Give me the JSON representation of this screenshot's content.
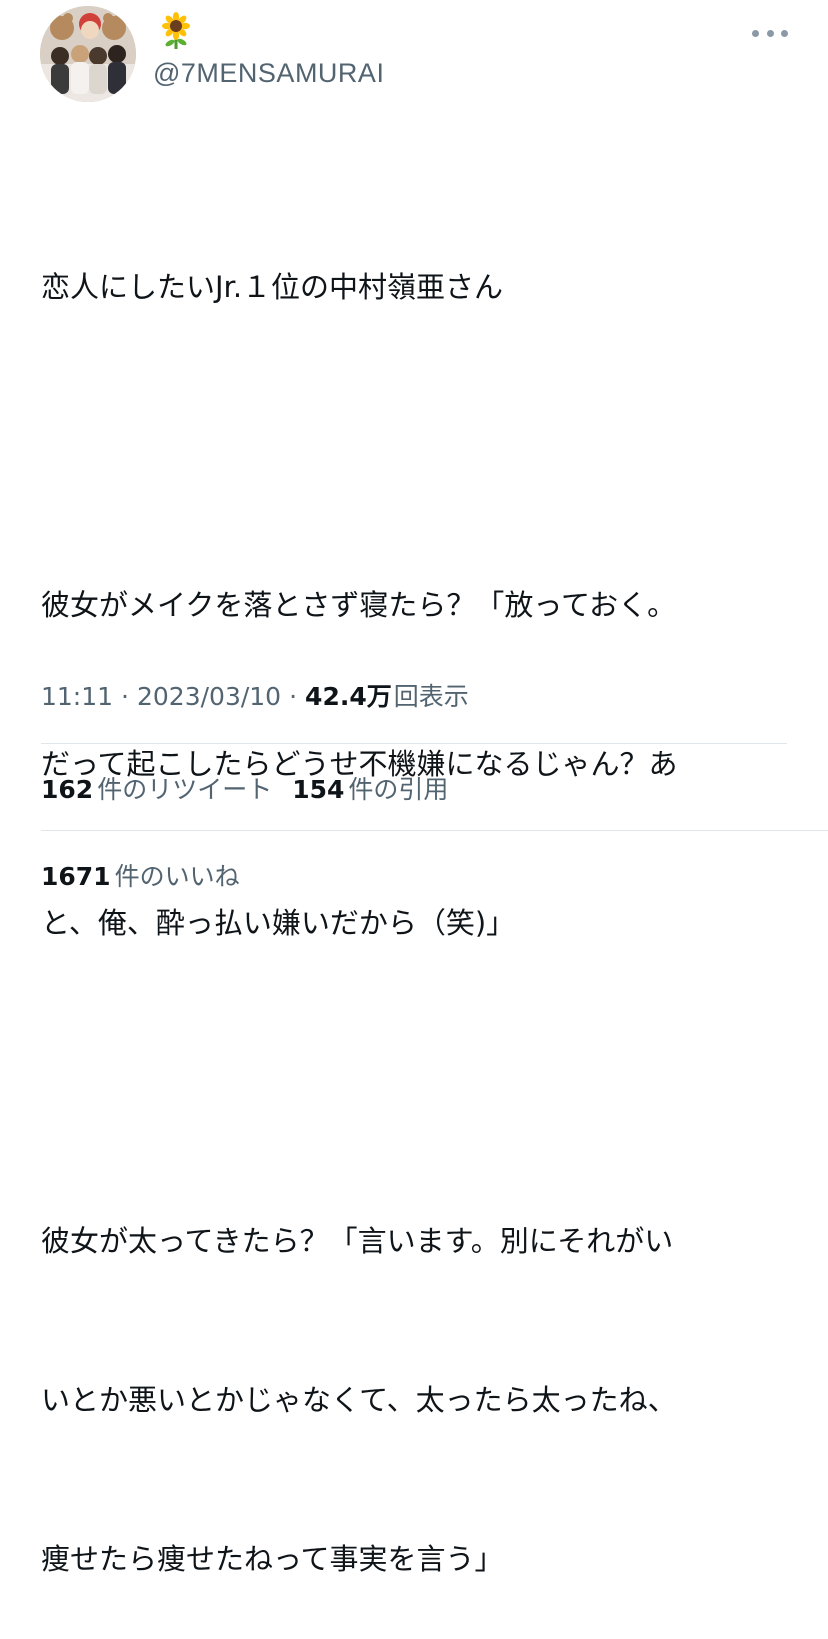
{
  "author": {
    "name_icon": "sunflower-emoji",
    "handle": "@7MENSAMURAI",
    "avatar": "avatar-photo"
  },
  "more_icon": "more-dots-icon",
  "tweet": {
    "lines": [
      "恋人にしたいJr.１位の中村嶺亜さん",
      "",
      "彼女がメイクを落とさず寝たら？「放っておく。",
      "だって起こしたらどうせ不機嫌になるじゃん？あ",
      "と、俺、酔っ払い嫌いだから（笑)」",
      "",
      "彼女が太ってきたら？「言います。別にそれがい",
      "いとか悪いとかじゃなくて、太ったら太ったね、",
      "痩せたら痩せたねって事実を言う」"
    ]
  },
  "meta": {
    "time": "11:11",
    "separator": "·",
    "date": "2023/03/10",
    "views_count": "42.4万",
    "views_label": "回表示"
  },
  "stats": {
    "retweets_count": "162",
    "retweets_label": "件のリツイート",
    "quotes_count": "154",
    "quotes_label": "件の引用",
    "likes_count": "1671",
    "likes_label": "件のいいね"
  },
  "colors": {
    "text_primary": "#0f1419",
    "text_secondary": "#536471",
    "divider": "#e1e6ea"
  }
}
